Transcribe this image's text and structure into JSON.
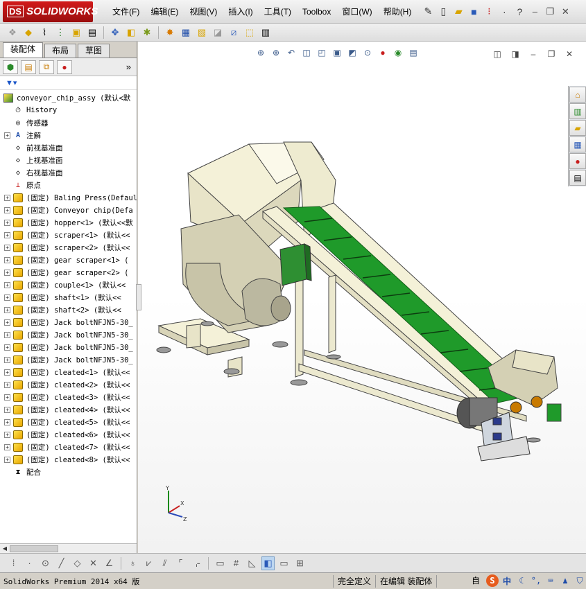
{
  "app": {
    "logo_text": "SOLIDWORKS",
    "logo_prefix": "DS"
  },
  "menu": {
    "items": [
      "文件(F)",
      "编辑(E)",
      "视图(V)",
      "插入(I)",
      "工具(T)",
      "Toolbox",
      "窗口(W)",
      "帮助(H)"
    ]
  },
  "panel": {
    "tabs": [
      "装配体",
      "布局",
      "草图"
    ],
    "active_tab": "装配体",
    "expand_label": "»"
  },
  "tree": {
    "root": "conveyor_chip_assy  (默认<默",
    "items": [
      {
        "text": "History",
        "icon": "history-icon",
        "expand": false
      },
      {
        "text": "传感器",
        "icon": "sensor-icon",
        "expand": false
      },
      {
        "text": "注解",
        "icon": "annotation-icon",
        "expand": true
      },
      {
        "text": "前视基准面",
        "icon": "plane-icon",
        "expand": false
      },
      {
        "text": "上视基准面",
        "icon": "plane-icon",
        "expand": false
      },
      {
        "text": "右视基准面",
        "icon": "plane-icon",
        "expand": false
      },
      {
        "text": "原点",
        "icon": "origin-icon",
        "expand": false
      },
      {
        "text": "(固定) Baling Press(Defaul",
        "icon": "part-icon",
        "expand": true
      },
      {
        "text": "(固定) Conveyor chip(Defa",
        "icon": "part-icon",
        "expand": true
      },
      {
        "text": "(固定) hopper<1> (默认<<默",
        "icon": "part-icon",
        "expand": true
      },
      {
        "text": "(固定) scraper<1> (默认<<",
        "icon": "part-icon",
        "expand": true
      },
      {
        "text": "(固定) scraper<2> (默认<<",
        "icon": "part-icon",
        "expand": true
      },
      {
        "text": "(固定) gear scraper<1> (",
        "icon": "part-icon",
        "expand": true
      },
      {
        "text": "(固定) gear scraper<2> (",
        "icon": "part-icon",
        "expand": true
      },
      {
        "text": "(固定) couple<1> (默认<<",
        "icon": "part-icon",
        "expand": true
      },
      {
        "text": "(固定) shaft<1> (默认<<",
        "icon": "part-icon",
        "expand": true
      },
      {
        "text": "(固定) shaft<2> (默认<<",
        "icon": "part-icon",
        "expand": true
      },
      {
        "text": "(固定) Jack boltNFJN5-30_",
        "icon": "part-icon",
        "expand": true
      },
      {
        "text": "(固定) Jack boltNFJN5-30_",
        "icon": "part-icon",
        "expand": true
      },
      {
        "text": "(固定) Jack boltNFJN5-30_",
        "icon": "part-icon",
        "expand": true
      },
      {
        "text": "(固定) Jack boltNFJN5-30_",
        "icon": "part-icon",
        "expand": true
      },
      {
        "text": "(固定) cleated<1> (默认<<",
        "icon": "part-icon",
        "expand": true
      },
      {
        "text": "(固定) cleated<2> (默认<<",
        "icon": "part-icon",
        "expand": true
      },
      {
        "text": "(固定) cleated<3> (默认<<",
        "icon": "part-icon",
        "expand": true
      },
      {
        "text": "(固定) cleated<4> (默认<<",
        "icon": "part-icon",
        "expand": true
      },
      {
        "text": "(固定) cleated<5> (默认<<",
        "icon": "part-icon",
        "expand": true
      },
      {
        "text": "(固定) cleated<6> (默认<<",
        "icon": "part-icon",
        "expand": true
      },
      {
        "text": "(固定) cleated<7> (默认<<",
        "icon": "part-icon",
        "expand": true
      },
      {
        "text": "(固定) cleated<8> (默认<<",
        "icon": "part-icon",
        "expand": true
      },
      {
        "text": "配合",
        "icon": "mates-icon",
        "expand": false
      }
    ]
  },
  "triad": {
    "x": "X",
    "y": "Y",
    "z": "Z"
  },
  "status": {
    "app": "SolidWorks Premium 2014 x64 版",
    "defined": "完全定义",
    "editing": "在编辑 装配体",
    "custom": "自"
  },
  "ime": {
    "logo": "S",
    "lang": "中"
  },
  "colors": {
    "accent": "#c8102e",
    "belt_green": "#1f9a2a",
    "frame_cream": "#f4f1d8",
    "selection_blue": "#bcd6f0"
  }
}
